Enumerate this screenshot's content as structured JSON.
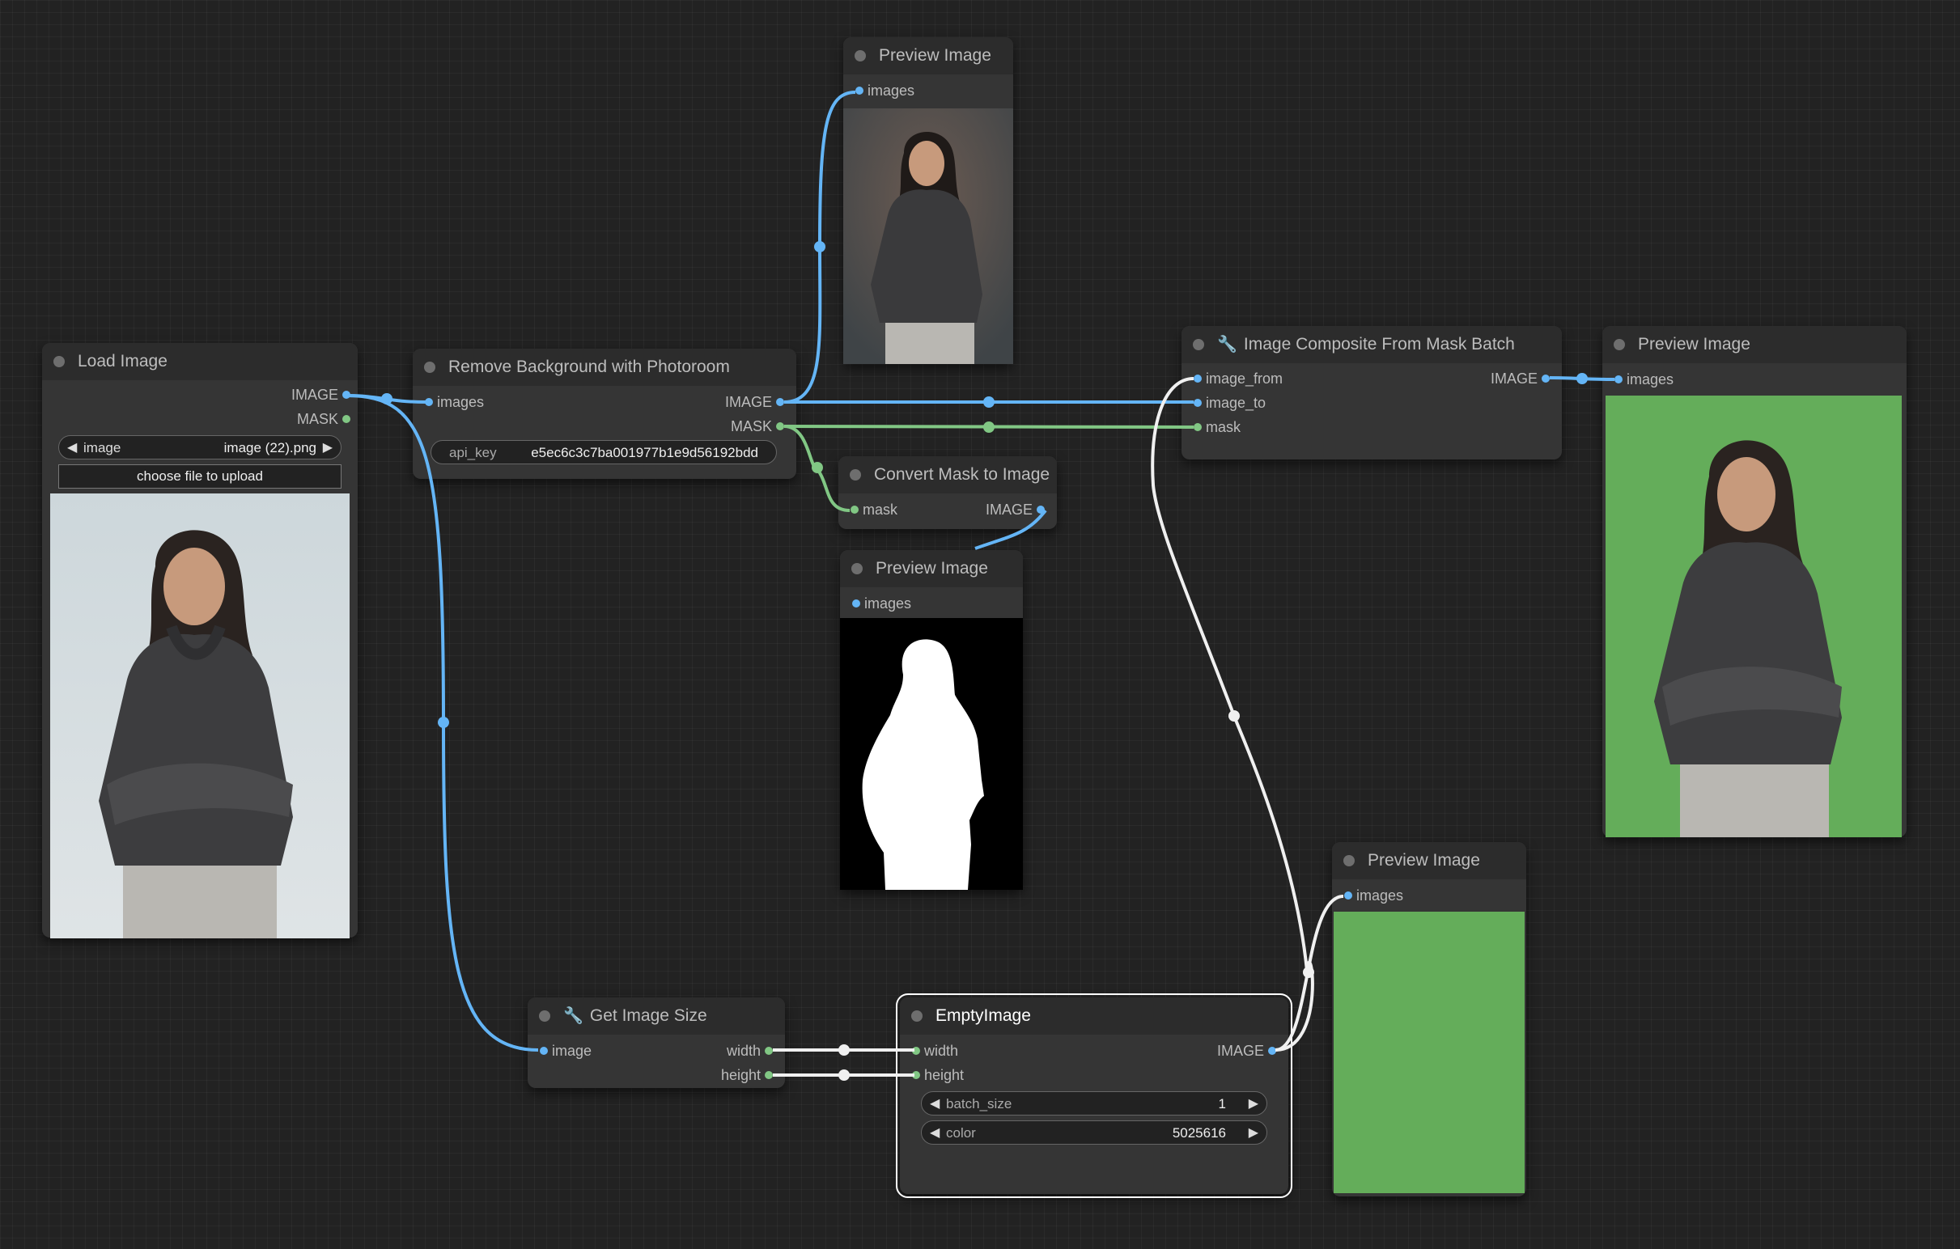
{
  "colors": {
    "canvas_bg": "#222222",
    "node_bg": "#353535",
    "node_title_bg": "#2c2c2c",
    "image_link": "#64b5f6",
    "mask_link": "#81c784",
    "int_link": "#ffffff",
    "green_fill": "#64ad5a"
  },
  "nodes": {
    "load_image": {
      "title": "Load Image",
      "outputs": [
        "IMAGE",
        "MASK"
      ],
      "image_widget": {
        "label": "image",
        "value": "image (22).png"
      },
      "upload_label": "choose file to upload"
    },
    "remove_bg": {
      "title": "Remove Background with Photoroom",
      "inputs": [
        "images"
      ],
      "outputs": [
        "IMAGE",
        "MASK"
      ],
      "api_key": {
        "label": "api_key",
        "value": "e5ec6c3c7ba001977b1e9d56192bdd"
      }
    },
    "preview_top": {
      "title": "Preview Image",
      "inputs": [
        "images"
      ]
    },
    "convert_mask": {
      "title": "Convert Mask to Image",
      "inputs": [
        "mask"
      ],
      "outputs": [
        "IMAGE"
      ]
    },
    "preview_mask": {
      "title": "Preview Image",
      "inputs": [
        "images"
      ]
    },
    "composite": {
      "title": "Image Composite From Mask Batch",
      "inputs": [
        "image_from",
        "image_to",
        "mask"
      ],
      "outputs": [
        "IMAGE"
      ]
    },
    "preview_result": {
      "title": "Preview Image",
      "inputs": [
        "images"
      ]
    },
    "get_size": {
      "title": "Get Image Size",
      "inputs": [
        "image"
      ],
      "outputs": [
        "width",
        "height"
      ]
    },
    "empty_image": {
      "title": "EmptyImage",
      "inputs": [
        "width",
        "height"
      ],
      "outputs": [
        "IMAGE"
      ],
      "batch_size": {
        "label": "batch_size",
        "value": "1"
      },
      "color": {
        "label": "color",
        "value": "5025616"
      }
    },
    "preview_green": {
      "title": "Preview Image",
      "inputs": [
        "images"
      ]
    }
  }
}
